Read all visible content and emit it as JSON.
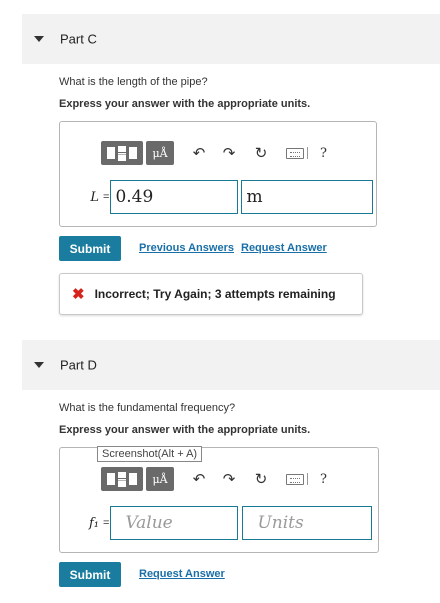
{
  "partC": {
    "title": "Part C",
    "question": "What is the length of the pipe?",
    "instruction": "Express your answer with the appropriate units.",
    "toolbar": {
      "mu_label": "μÅ",
      "help": "?"
    },
    "variable": "L",
    "equals": "=",
    "value": "0.49",
    "units": "m",
    "submit": "Submit",
    "previous_answers": "Previous Answers",
    "request_answer": "Request Answer",
    "feedback": "Incorrect; Try Again; 3 attempts remaining"
  },
  "partD": {
    "title": "Part D",
    "question": "What is the fundamental frequency?",
    "instruction": "Express your answer with the appropriate units.",
    "tooltip": "Screenshot(Alt + A)",
    "toolbar": {
      "mu_label": "μÅ",
      "help": "?"
    },
    "variable": "f₁",
    "equals": "=",
    "value_placeholder": "Value",
    "units_placeholder": "Units",
    "submit": "Submit",
    "request_answer": "Request Answer"
  },
  "colors": {
    "accent": "#1a7da0",
    "link": "#1a6fa8",
    "error": "#d6241c"
  }
}
